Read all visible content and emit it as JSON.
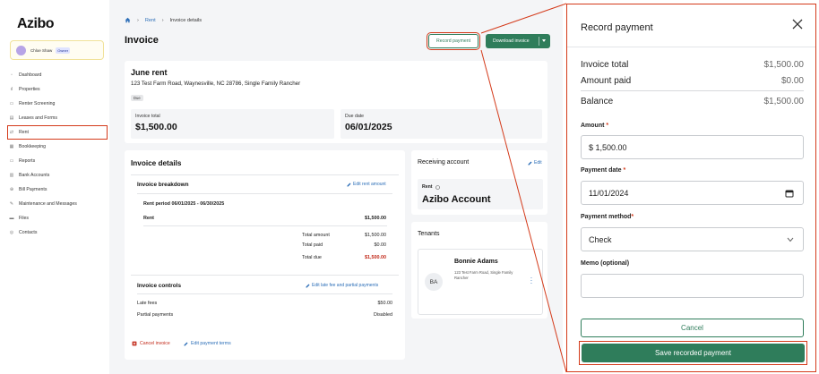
{
  "app": {
    "logo": "Azibo"
  },
  "user": {
    "name": "Chloe Shaw",
    "role": "Owner"
  },
  "sidebar": {
    "items": [
      {
        "label": "Dashboard",
        "icon": "dashboard-icon"
      },
      {
        "label": "Properties",
        "icon": "chart-icon"
      },
      {
        "label": "Renter Screening",
        "icon": "screening-icon"
      },
      {
        "label": "Leases and Forms",
        "icon": "document-icon"
      },
      {
        "label": "Rent",
        "icon": "rent-icon"
      },
      {
        "label": "Bookkeeping",
        "icon": "ledger-icon"
      },
      {
        "label": "Reports",
        "icon": "report-icon"
      },
      {
        "label": "Bank Accounts",
        "icon": "bank-icon"
      },
      {
        "label": "Bill Payments",
        "icon": "bill-icon"
      },
      {
        "label": "Maintenance and Messages",
        "icon": "wrench-icon"
      },
      {
        "label": "Files",
        "icon": "folder-icon"
      },
      {
        "label": "Contacts",
        "icon": "contacts-icon"
      }
    ],
    "active_index": 4
  },
  "breadcrumb": {
    "parent": "Rent",
    "current": "Invoice details"
  },
  "page": {
    "title": "Invoice"
  },
  "actions": {
    "record_payment": "Record payment",
    "download_invoice": "Download invoice"
  },
  "rent": {
    "title": "June rent",
    "address": "123 Test Farm Road, Waynesville, NC 28786, Single Family Rancher",
    "status": "Due",
    "invoice_total_label": "Invoice total",
    "invoice_total": "$1,500.00",
    "due_date_label": "Due date",
    "due_date": "06/01/2025"
  },
  "details": {
    "title": "Invoice details",
    "breakdown_title": "Invoice breakdown",
    "edit_rent_amount": "Edit rent amount",
    "rent_period": "Rent period 06/01/2025 - 06/30/2025",
    "rent_label": "Rent",
    "rent_value": "$1,500.00",
    "total_amount_label": "Total amount",
    "total_amount": "$1,500.00",
    "total_paid_label": "Total paid",
    "total_paid": "$0.00",
    "total_due_label": "Total due",
    "total_due": "$1,500.00",
    "controls_title": "Invoice controls",
    "edit_late_fee": "Edit late fee and partial payments",
    "late_fees_label": "Late fees",
    "late_fees": "$50.00",
    "partial_label": "Partial payments",
    "partial_value": "Disabled",
    "cancel_invoice": "Cancel invoice",
    "edit_payment_terms": "Edit payment terms"
  },
  "receiving": {
    "title": "Receiving account",
    "edit": "Edit",
    "label": "Rent",
    "account": "Azibo Account"
  },
  "tenants": {
    "title": "Tenants",
    "name": "Bonnie Adams",
    "initials": "BA",
    "address": "123 Test Farm Road, Single Family Rancher"
  },
  "drawer": {
    "title": "Record payment",
    "invoice_total_label": "Invoice total",
    "invoice_total": "$1,500.00",
    "amount_paid_label": "Amount paid",
    "amount_paid": "$0.00",
    "balance_label": "Balance",
    "balance": "$1,500.00",
    "amount_label": "Amount",
    "amount_value": "$ 1,500.00",
    "date_label": "Payment date",
    "date_value": "11/01/2024",
    "method_label": "Payment method",
    "method_value": "Check",
    "memo_label": "Memo (optional)",
    "memo_value": "",
    "cancel": "Cancel",
    "save": "Save recorded payment"
  },
  "colors": {
    "brand": "#2f7d5b",
    "highlight": "#d43a1a",
    "link": "#2d6fb8"
  }
}
